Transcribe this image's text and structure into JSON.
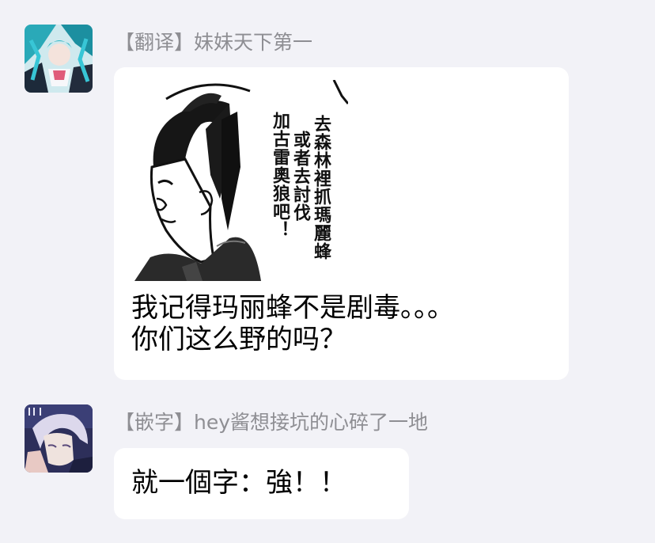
{
  "messages": [
    {
      "sender": "【翻译】妹妹天下第一",
      "avatar": "anime-girl-teal-hair-avatar",
      "image": {
        "speech_col_1": "去森林裡抓瑪麗蜂",
        "speech_col_2": "或者去討伐",
        "speech_col_3": "加古雷奧狼吧！"
      },
      "text_line1": "我记得玛丽蜂不是剧毒。。。",
      "text_line2": "你们这么野的吗？"
    },
    {
      "sender": "【嵌字】hey酱想接坑的心碎了一地",
      "avatar": "anime-boy-silver-hair-avatar",
      "text": "就一個字：強！！"
    }
  ],
  "colors": {
    "background": "#f2f2f7",
    "bubble": "#ffffff",
    "sender_text": "#8e8e93",
    "message_text": "#000000"
  }
}
